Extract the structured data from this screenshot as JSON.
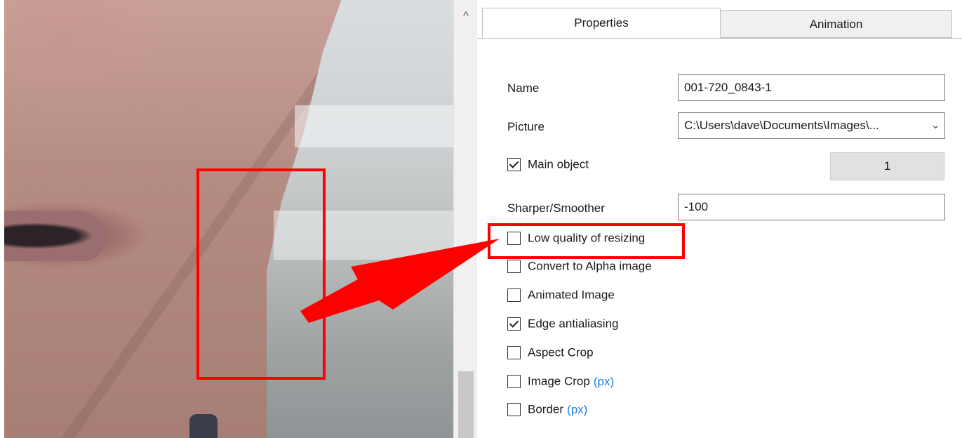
{
  "scrollbar": {
    "up_icon": "chevron-up-icon",
    "up_glyph": "^"
  },
  "tabs": [
    {
      "label": "Properties",
      "active": true
    },
    {
      "label": "Animation",
      "active": false
    }
  ],
  "properties": {
    "name_label": "Name",
    "name_value": "001-720_0843-1",
    "picture_label": "Picture",
    "picture_value": "C:\\Users\\dave\\Documents\\Images\\...",
    "main_object_label": "Main object",
    "main_object_checked": true,
    "main_object_number": "1",
    "sharper_label": "Sharper/Smoother",
    "sharper_value": "-100",
    "options": [
      {
        "label": "Low quality of resizing",
        "checked": false,
        "suffix": ""
      },
      {
        "label": "Convert to Alpha image",
        "checked": false,
        "suffix": ""
      },
      {
        "label": "Animated Image",
        "checked": false,
        "suffix": ""
      },
      {
        "label": "Edge antialiasing",
        "checked": true,
        "suffix": ""
      },
      {
        "label": "Aspect Crop",
        "checked": false,
        "suffix": ""
      },
      {
        "label": "Image Crop",
        "checked": false,
        "suffix": "(px)"
      },
      {
        "label": "Border",
        "checked": false,
        "suffix": "(px)"
      }
    ]
  },
  "annotation": {
    "color": "#ff0000"
  }
}
